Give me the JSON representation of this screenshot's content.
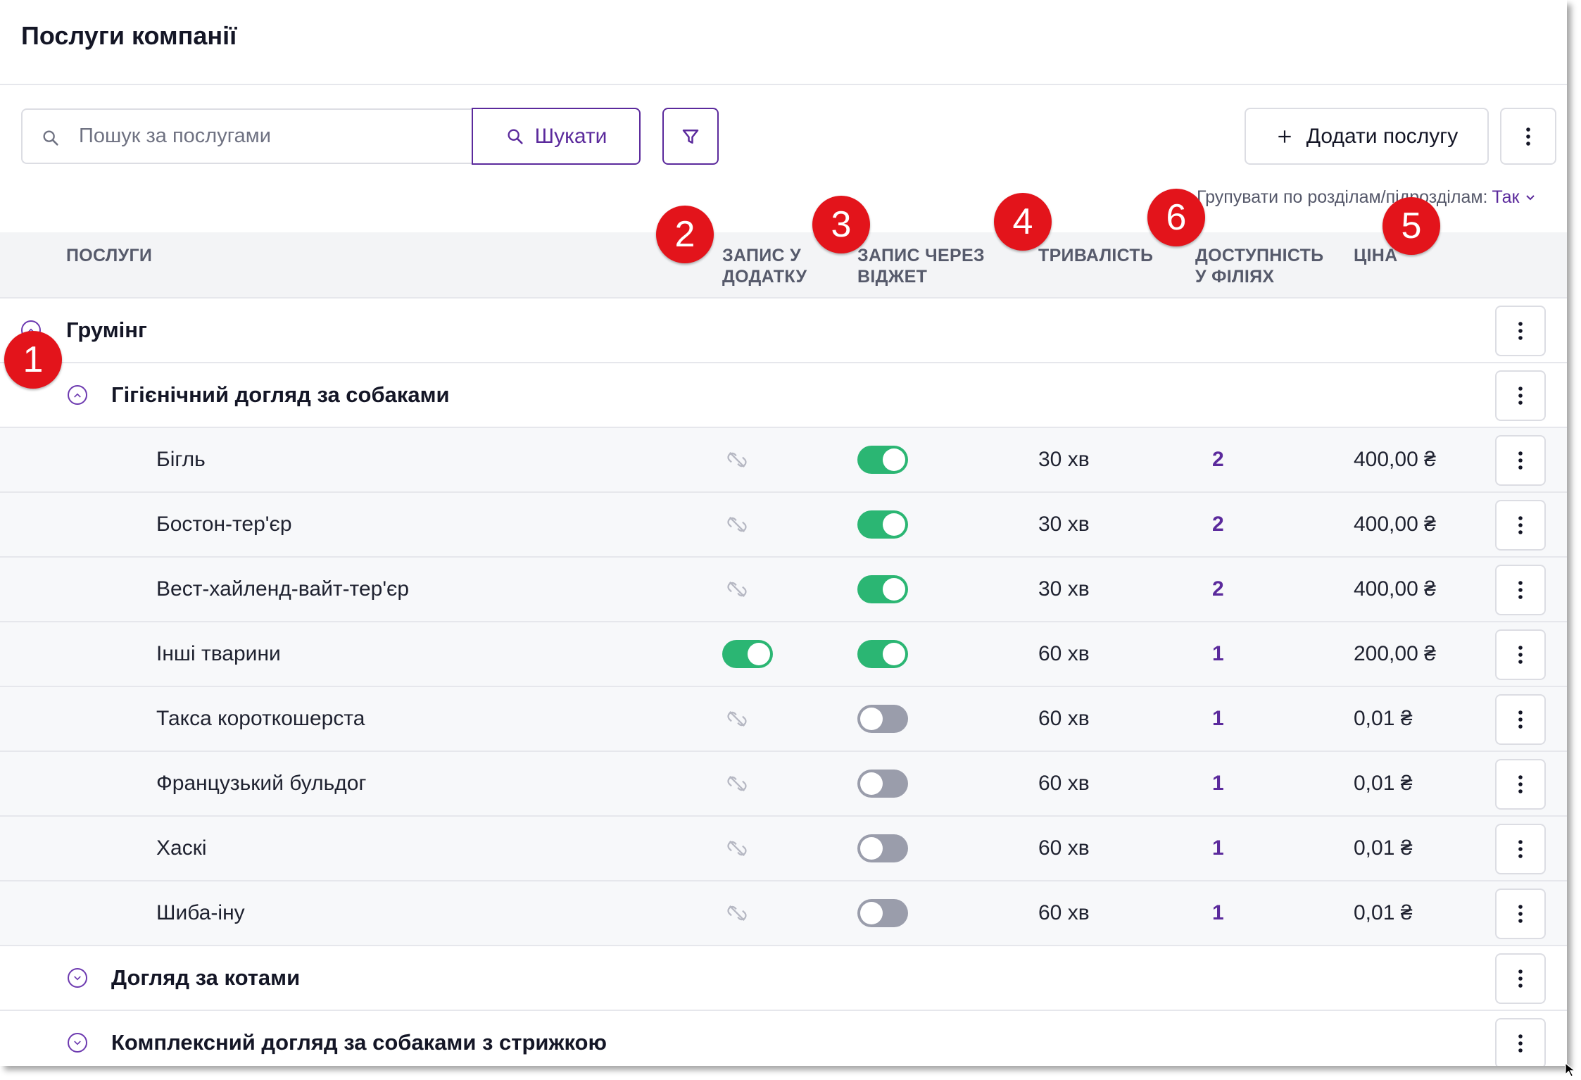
{
  "page": {
    "title": "Послуги компанії"
  },
  "toolbar": {
    "search_placeholder": "Пошук за послугами",
    "search_button": "Шукати",
    "add_button": "Додати послугу"
  },
  "grouping": {
    "label": "Групувати по розділам/підрозділам:",
    "value": "Так"
  },
  "columns": {
    "services": "Послуги",
    "app_booking": [
      "Запис у",
      "додатку"
    ],
    "widget_booking": [
      "Запис через",
      "віджет"
    ],
    "duration": "Тривалість",
    "branches": [
      "Доступність",
      "у філіях"
    ],
    "price": "Ціна"
  },
  "groups": [
    {
      "name": "Грумінг",
      "expanded": true,
      "subgroups": [
        {
          "name": "Гігієнічний догляд за собаками",
          "expanded": true,
          "items": [
            {
              "name": "Бігль",
              "app_booking": "unavailable",
              "widget": true,
              "duration": "30 хв",
              "branches": "2",
              "price": "400,00 ₴"
            },
            {
              "name": "Бостон-тер'єр",
              "app_booking": "unavailable",
              "widget": true,
              "duration": "30 хв",
              "branches": "2",
              "price": "400,00 ₴"
            },
            {
              "name": "Вест-хайленд-вайт-тер'єр",
              "app_booking": "unavailable",
              "widget": true,
              "duration": "30 хв",
              "branches": "2",
              "price": "400,00 ₴"
            },
            {
              "name": "Інші тварини",
              "app_booking": "on",
              "widget": true,
              "duration": "60 хв",
              "branches": "1",
              "price": "200,00 ₴"
            },
            {
              "name": "Такса короткошерста",
              "app_booking": "unavailable",
              "widget": false,
              "duration": "60 хв",
              "branches": "1",
              "price": "0,01 ₴"
            },
            {
              "name": "Французький бульдог",
              "app_booking": "unavailable",
              "widget": false,
              "duration": "60 хв",
              "branches": "1",
              "price": "0,01 ₴"
            },
            {
              "name": "Хаскі",
              "app_booking": "unavailable",
              "widget": false,
              "duration": "60 хв",
              "branches": "1",
              "price": "0,01 ₴"
            },
            {
              "name": "Шиба-іну",
              "app_booking": "unavailable",
              "widget": false,
              "duration": "60 хв",
              "branches": "1",
              "price": "0,01 ₴"
            }
          ]
        },
        {
          "name": "Догляд за котами",
          "expanded": false
        },
        {
          "name": "Комплексний догляд за собаками з стрижкою",
          "expanded": false
        }
      ]
    }
  ],
  "annotations": [
    "1",
    "2",
    "3",
    "4",
    "5",
    "6"
  ],
  "colors": {
    "accent": "#5b2a9c",
    "toggle_on": "#2bb673",
    "toggle_off": "#9a9dab",
    "badge": "#e3141b"
  },
  "icons": {
    "search": "search-icon",
    "filter": "filter-icon",
    "add": "plus-icon",
    "more": "kebab-icon",
    "collapse": "chevron-up-icon",
    "expand": "chevron-down-icon",
    "unavailable": "broken-link-icon"
  }
}
